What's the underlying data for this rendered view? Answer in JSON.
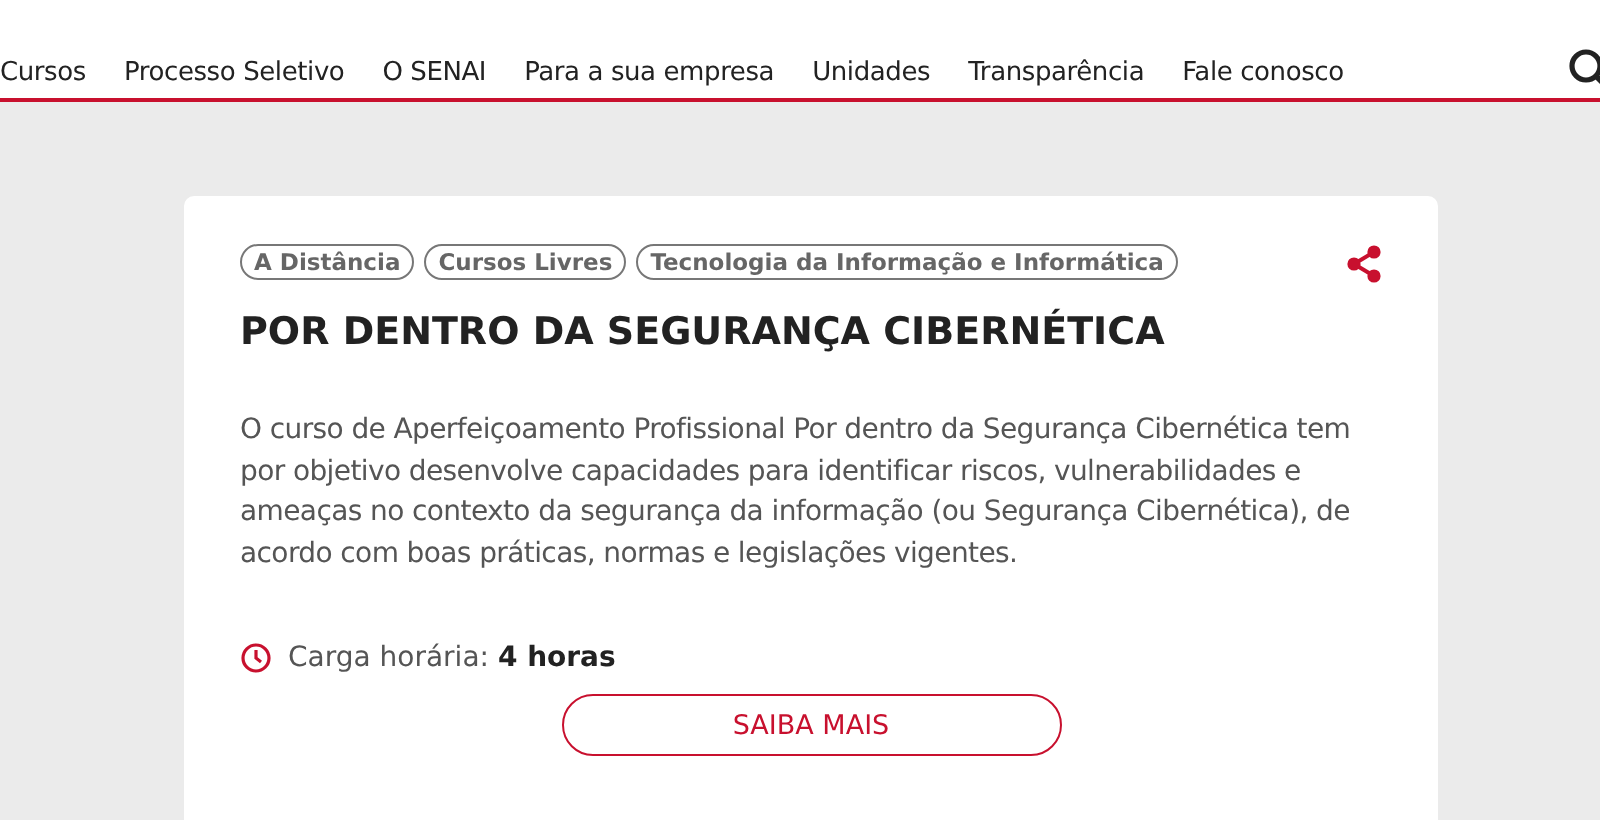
{
  "nav": {
    "items": [
      "Cursos",
      "Processo Seletivo",
      "O SENAI",
      "Para a sua empresa",
      "Unidades",
      "Transparência",
      "Fale conosco"
    ]
  },
  "course": {
    "tags": [
      "A Distância",
      "Cursos Livres",
      "Tecnologia da Informação e Informática"
    ],
    "title": "POR DENTRO DA SEGURANÇA CIBERNÉTICA",
    "description": "O curso de Aperfeiçoamento Profissional Por dentro da Segurança Cibernética tem por objetivo desenvolve capacidades para identificar riscos, vulnerabilidades e ameaças no contexto da segurança da informação (ou Segurança Cibernética), de acordo com boas práticas, normas e legislações vigentes.",
    "workload": "Carga horária: **4 horas**",
    "button": "SAIBA MAIS"
  }
}
